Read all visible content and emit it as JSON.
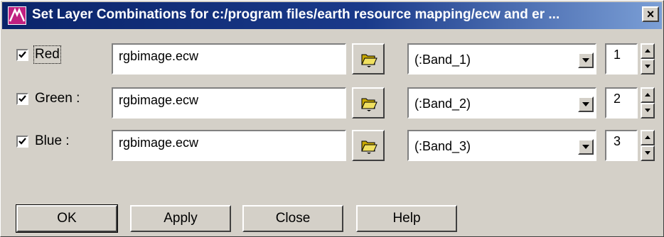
{
  "window": {
    "title": "Set Layer Combinations for c:/program files/earth resource mapping/ecw and er ...",
    "close_label": "×"
  },
  "rows": [
    {
      "checked": true,
      "label": "Red",
      "file": "rgbimage.ecw",
      "band": "(:Band_1)",
      "index": "1"
    },
    {
      "checked": true,
      "label": "Green :",
      "file": "rgbimage.ecw",
      "band": "(:Band_2)",
      "index": "2"
    },
    {
      "checked": true,
      "label": "Blue :",
      "file": "rgbimage.ecw",
      "band": "(:Band_3)",
      "index": "3"
    }
  ],
  "buttons": {
    "ok": "OK",
    "apply": "Apply",
    "close": "Close",
    "help": "Help"
  },
  "icons": {
    "app": "layers-app-icon",
    "browse": "folder-open-icon",
    "dropdown": "chevron-down-icon",
    "spin_up": "spin-up-icon",
    "spin_down": "spin-down-icon"
  },
  "colors": {
    "titlebar_start": "#0a246a",
    "titlebar_end": "#7b9fd6",
    "face": "#d4d0c8"
  }
}
